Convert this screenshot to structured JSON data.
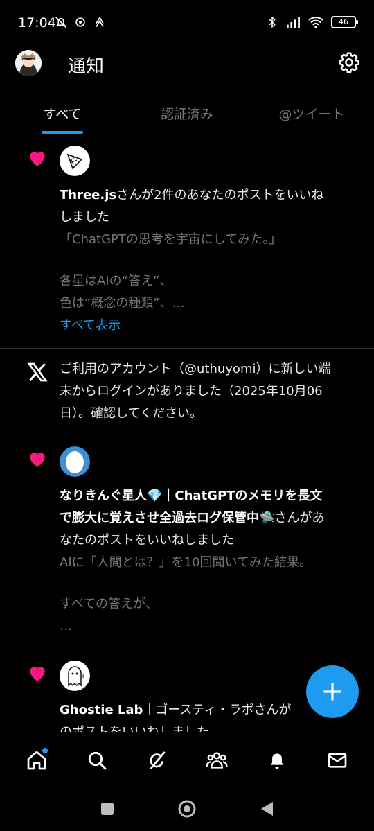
{
  "status_bar": {
    "time": "17:04",
    "battery": "46"
  },
  "header": {
    "title": "通知"
  },
  "tabs": [
    {
      "label": "すべて",
      "active": true
    },
    {
      "label": "認証済み",
      "active": false
    },
    {
      "label": "@ツイート",
      "active": false
    }
  ],
  "notifications": [
    {
      "type": "like",
      "icon": "heart-icon",
      "bold": "Three.js",
      "text_1": "さんが2件のあなたのポストをいいね",
      "text_2": "しました",
      "quote_1": "「ChatGPTの思考を宇宙にしてみた。」",
      "quote_2": "各星はAIの“答え”、",
      "quote_3": "色は“概念の種類”、…",
      "show_all": "すべて表示"
    },
    {
      "type": "system",
      "icon": "x-logo-icon",
      "line_1": "ご利用のアカウント（@uthuyomi）に新しい端",
      "line_2": "末からログインがありました（2025年10月06",
      "line_3": "日）。確認してください。"
    },
    {
      "type": "like",
      "icon": "heart-icon",
      "line_1_bold": "なりきんぐ星人💎｜ChatGPTのメモリを長文",
      "line_2_bold": "で膨大に覚えさせ全過去ログ保管中🛸",
      "line_2_rest": "さんがあ",
      "line_3": "なたのポストをいいねしました",
      "quote_1": "AIに「人間とは？」を10回聞いてみた結果。",
      "quote_2": "すべての答えが、",
      "quote_3": "…"
    },
    {
      "type": "like",
      "icon": "heart-icon",
      "line_1_bold": "Ghostie Lab",
      "line_1_rest": "｜ゴースティ・ラボさんが",
      "line_2": "のポストをいいねしました"
    }
  ],
  "colors": {
    "accent": "#1d9bf0",
    "heart": "#f91880",
    "background": "#000000",
    "divider": "#2f3336"
  }
}
